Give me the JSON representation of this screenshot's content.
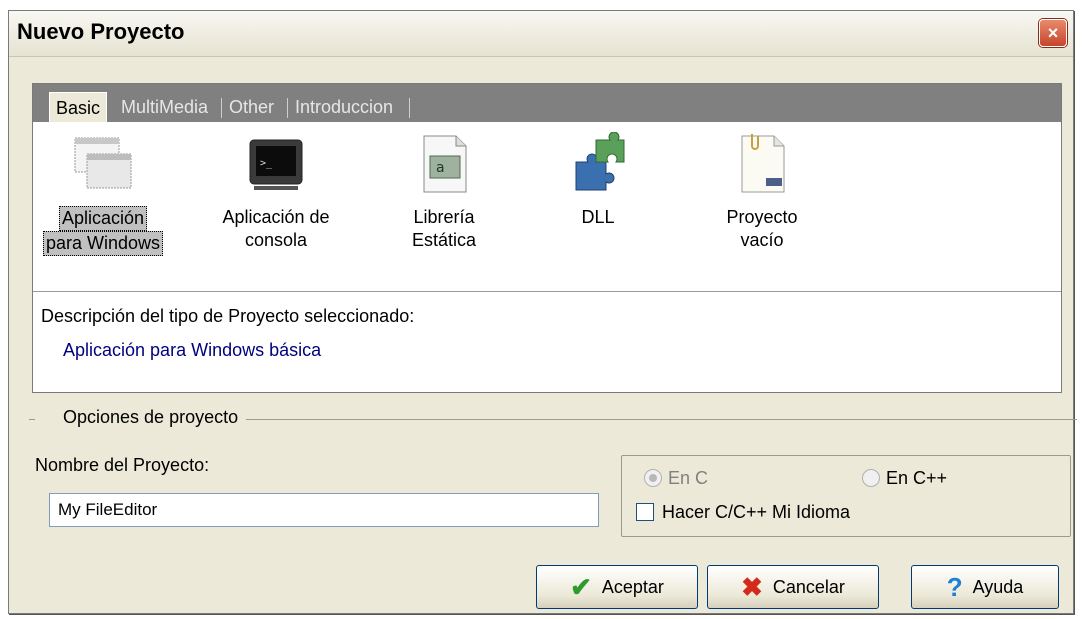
{
  "window": {
    "title": "Nuevo Proyecto",
    "close_label": "×"
  },
  "tabs": [
    {
      "label": "Basic",
      "active": true
    },
    {
      "label": "MultiMedia",
      "active": false
    },
    {
      "label": "Other",
      "active": false
    },
    {
      "label": "Introduccion",
      "active": false
    }
  ],
  "projects": [
    {
      "line1": "Aplicación",
      "line2": "para Windows",
      "icon": "windows-app-icon",
      "selected": true
    },
    {
      "line1": "Aplicación de",
      "line2": "consola",
      "icon": "console-icon",
      "selected": false
    },
    {
      "line1": "Librería",
      "line2": "Estática",
      "icon": "static-library-icon",
      "selected": false
    },
    {
      "line1": "DLL",
      "line2": "",
      "icon": "dll-puzzle-icon",
      "selected": false
    },
    {
      "line1": "Proyecto",
      "line2": "vacío",
      "icon": "empty-project-icon",
      "selected": false
    }
  ],
  "description": {
    "title": "Descripción del tipo de Proyecto seleccionado:",
    "value": "Aplicación para Windows básica"
  },
  "options": {
    "legend": "Opciones de proyecto",
    "name_label": "Nombre del Proyecto:",
    "name_value": "My FileEditor",
    "radio_c_label": "En C",
    "radio_cpp_label": "En C++",
    "checkbox_label": "Hacer C/C++ Mi Idioma"
  },
  "buttons": {
    "ok": "Aceptar",
    "cancel": "Cancelar",
    "help": "Ayuda"
  },
  "colors": {
    "dialog_bg": "#ece9d8",
    "tabstrip_bg": "#808080",
    "description_text": "#000080"
  }
}
